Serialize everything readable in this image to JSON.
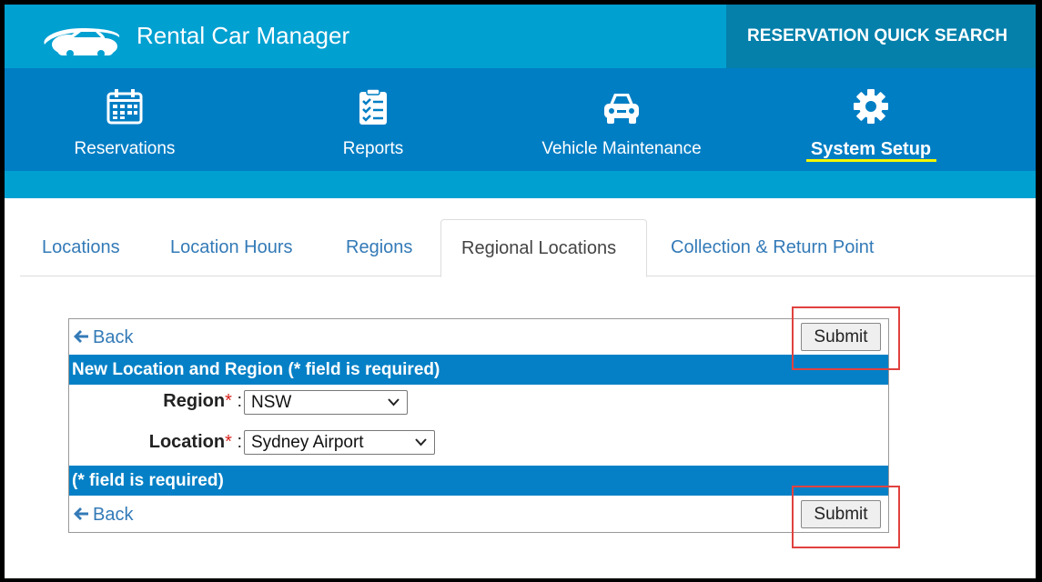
{
  "header": {
    "app_title": "Rental Car Manager",
    "quick_search": "RESERVATION QUICK SEARCH"
  },
  "nav": {
    "items": [
      {
        "label": "Reservations",
        "icon": "calendar-icon"
      },
      {
        "label": "Reports",
        "icon": "checklist-icon"
      },
      {
        "label": "Vehicle Maintenance",
        "icon": "car-icon"
      },
      {
        "label": "System Setup",
        "icon": "gear-icon",
        "active": true
      }
    ]
  },
  "tabs": [
    {
      "label": "Locations"
    },
    {
      "label": "Location Hours"
    },
    {
      "label": "Regions"
    },
    {
      "label": "Regional Locations",
      "active": true
    },
    {
      "label": "Collection & Return Point"
    }
  ],
  "form": {
    "back_label": "Back",
    "submit_label": "Submit",
    "title": "New Location and Region (* field is required)",
    "footer_note": "(* field is required)",
    "region": {
      "label": "Region",
      "required_mark": "*",
      "colon": ":",
      "value": "NSW"
    },
    "location": {
      "label": "Location",
      "required_mark": "*",
      "colon": ":",
      "value": "Sydney Airport"
    }
  },
  "colors": {
    "header_blue": "#00a0d1",
    "nav_blue": "#007ec4",
    "quick_search_bg": "#0580ab",
    "active_underline": "#f3f700",
    "link_blue": "#337ab7",
    "highlight_red": "#e0423f"
  }
}
